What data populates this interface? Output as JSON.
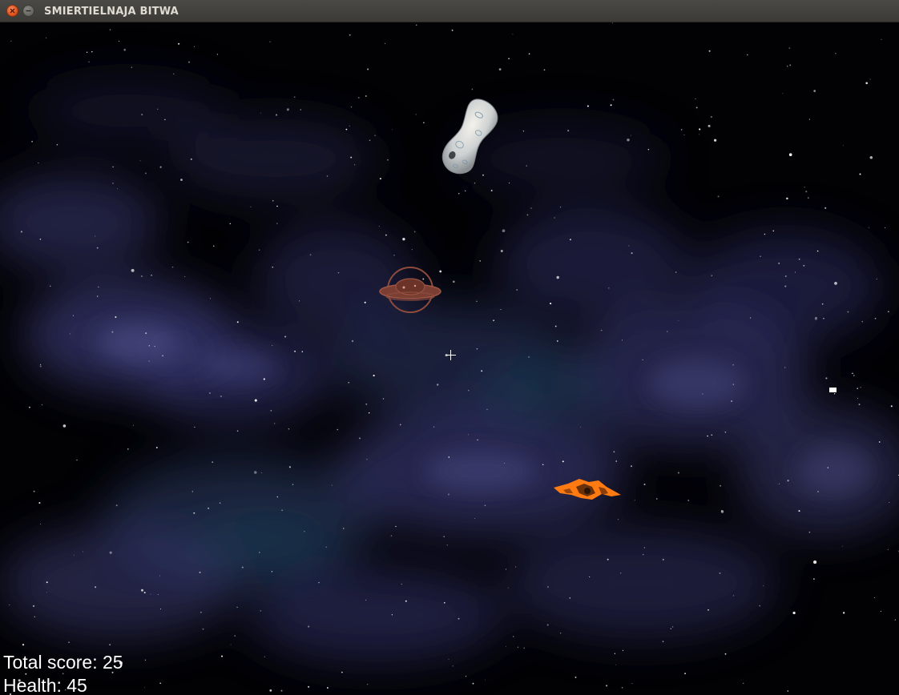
{
  "window": {
    "title": "SMIERTIELNAJA BITWA",
    "close_icon": "close-icon",
    "minimize_icon": "minimize-icon"
  },
  "hud": {
    "score_label": "Total score:",
    "score_value": "25",
    "health_label": "Health:",
    "health_value": "45"
  },
  "scene": {
    "background": "starfield-nebula",
    "objects": [
      "asteroid",
      "enemy-saucer",
      "player-ship",
      "projectile",
      "crosshair"
    ]
  },
  "colors": {
    "nebula": "#4a4a8a",
    "player_ship": "#ff7a10",
    "enemy_saucer": "#8a4a3a",
    "hud_text": "#ffffff"
  }
}
